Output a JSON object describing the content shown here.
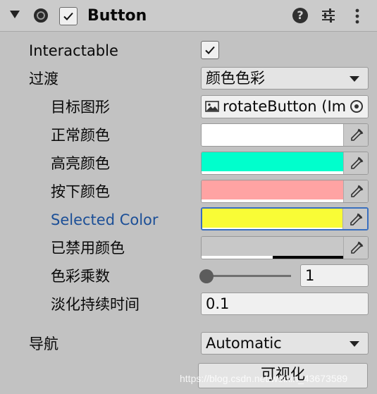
{
  "header": {
    "title": "Button",
    "enabled": true,
    "help_glyph": "?"
  },
  "fields": {
    "interactable_label": "Interactable",
    "interactable_checked": true,
    "transition_label": "过渡",
    "transition_value": "颜色色彩",
    "target_graphic_label": "目标图形",
    "target_graphic_value": "rotateButton (Image)",
    "normal_color_label": "正常颜色",
    "highlighted_color_label": "高亮颜色",
    "pressed_color_label": "按下颜色",
    "selected_color_label": "Selected Color",
    "disabled_color_label": "已禁用颜色",
    "color_multiplier_label": "色彩乘数",
    "color_multiplier_value": "1",
    "fade_duration_label": "淡化持续时间",
    "fade_duration_value": "0.1",
    "navigation_label": "导航",
    "navigation_value": "Automatic",
    "visualize_button": "可视化"
  },
  "colors": {
    "normal": "#ffffff",
    "highlighted": "#00ffcc",
    "pressed": "#ffa3a3",
    "selected": "#f9fc36",
    "disabled": "#c8c8c8"
  },
  "icons": {
    "fold": "triangle-down-icon",
    "enabled": "component-enabled-icon",
    "help": "help-icon",
    "presets": "sliders-icon",
    "menu": "kebab-menu-icon",
    "image": "image-icon",
    "object_picker": "object-picker-icon",
    "eyedropper": "eyedropper-icon"
  },
  "watermark": "https://blog.csdn.net/weixin_43673589"
}
